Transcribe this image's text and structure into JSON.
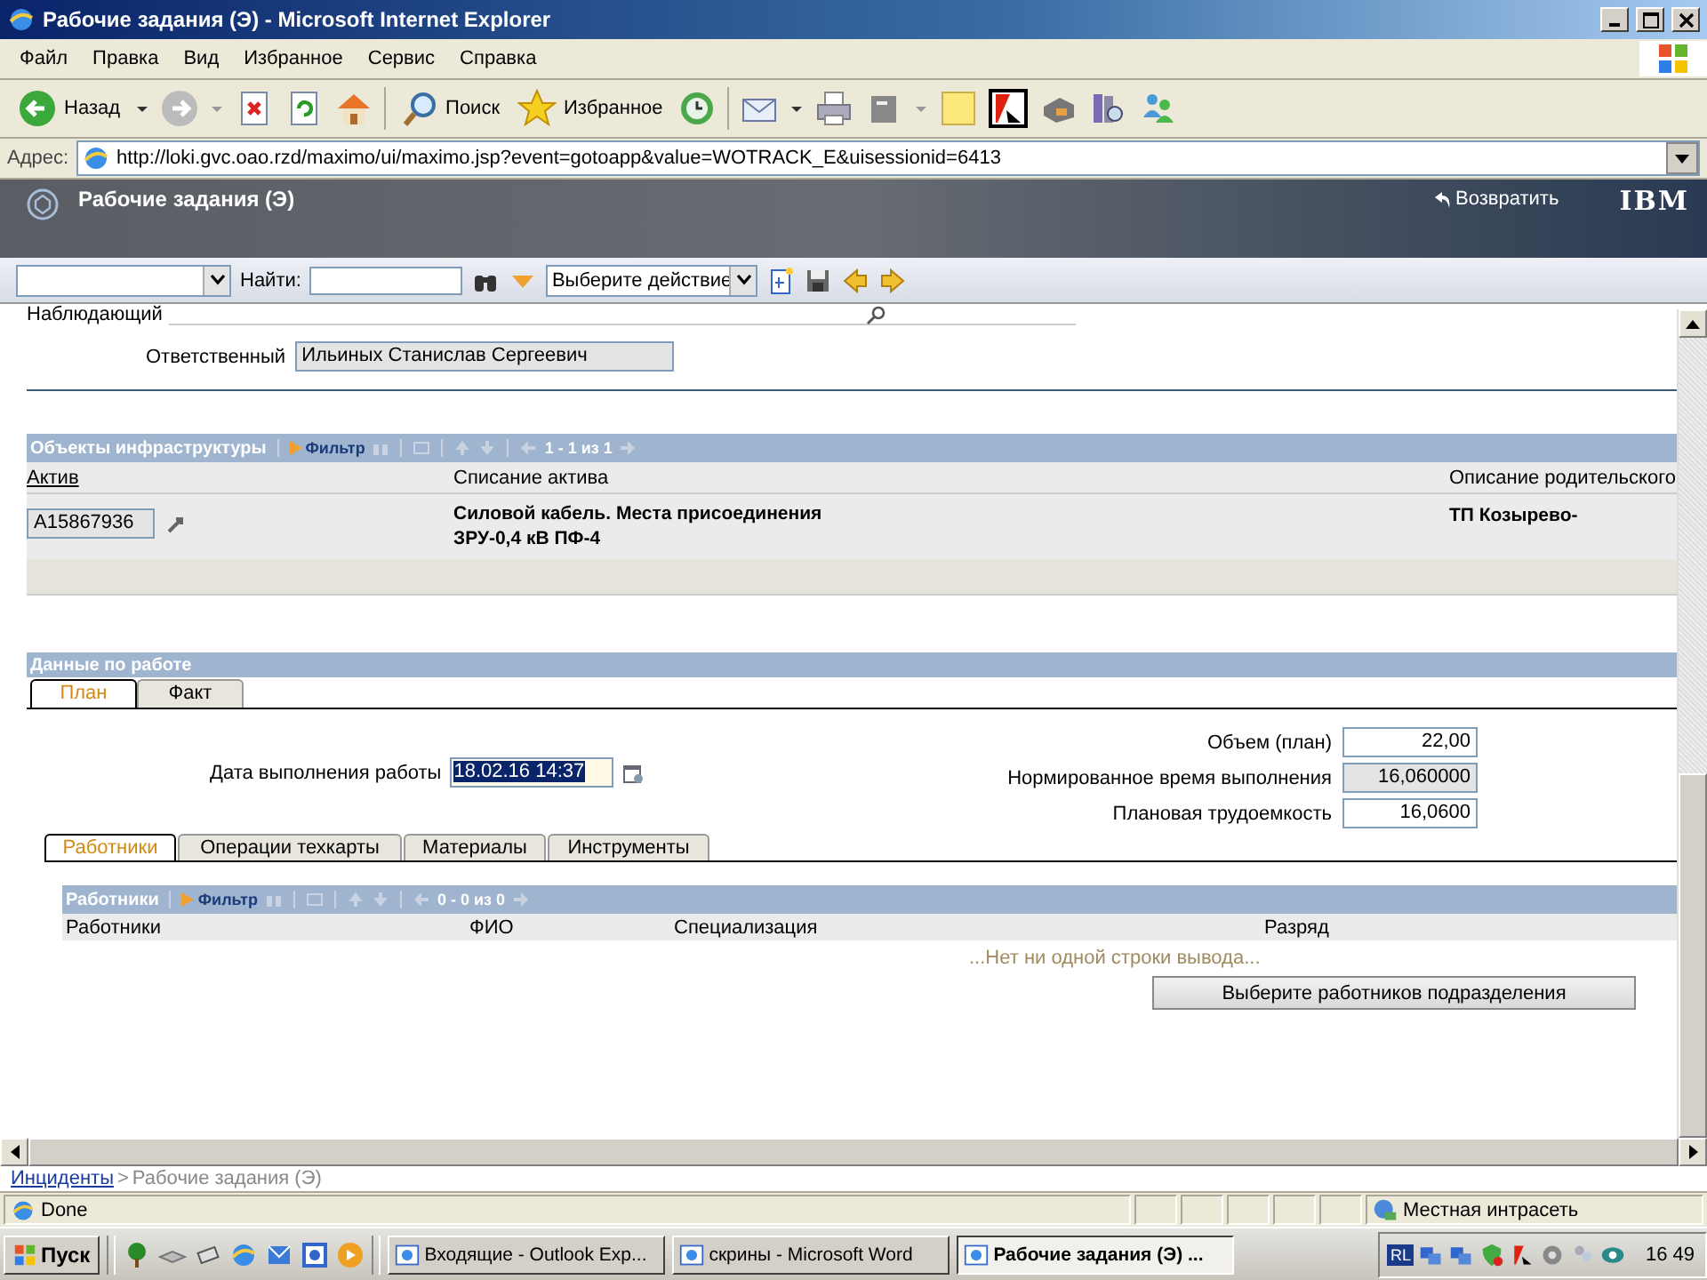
{
  "window": {
    "title": "Рабочие задания (Э) - Microsoft Internet Explorer"
  },
  "menu": [
    "Файл",
    "Правка",
    "Вид",
    "Избранное",
    "Сервис",
    "Справка"
  ],
  "toolbar": {
    "back": "Назад",
    "search": "Поиск",
    "favorites": "Избранное"
  },
  "address": {
    "label": "Адрес:",
    "url": "http://loki.gvc.oao.rzd/maximo/ui/maximo.jsp?event=gotoapp&value=WOTRACK_E&uisessionid=6413"
  },
  "app_header": {
    "title": "Рабочие задания (Э)",
    "return_link": "Возвратить",
    "logo": "IBM"
  },
  "app_toolbar": {
    "find_label": "Найти:",
    "action_select": "Выберите действие"
  },
  "form": {
    "observer_label": "Наблюдающий",
    "responsible_label": "Ответственный",
    "responsible_value": "Ильиных Станислав Сергеевич"
  },
  "assets": {
    "title": "Объекты инфраструктуры",
    "filter": "Фильтр",
    "pager": "1 - 1 из 1",
    "columns": [
      "Актив",
      "Списание актива",
      "Описание родительского"
    ],
    "rows": [
      {
        "asset": "A15867936",
        "description": "Силовой кабель. Места присоединения ЗРУ-0,4 кВ ПФ-4",
        "parent": "ТП Козырево-"
      }
    ]
  },
  "work": {
    "title": "Данные по работе",
    "tabs": [
      {
        "label": "План",
        "selected": true
      },
      {
        "label": "Факт",
        "selected": false
      }
    ],
    "date_label": "Дата выполнения работы",
    "date_value": "18.02.16 14:37",
    "date_highlighted": true,
    "fields": [
      {
        "label": "Объем (план)",
        "value": "22,00",
        "readonly": false
      },
      {
        "label": "Нормированное время выполнения",
        "value": "16,060000",
        "readonly": true
      },
      {
        "label": "Плановая трудоемкость",
        "value": "16,0600",
        "readonly": false
      }
    ]
  },
  "subtabs": [
    {
      "label": "Работники",
      "selected": true
    },
    {
      "label": "Операции техкарты",
      "selected": false
    },
    {
      "label": "Материалы",
      "selected": false
    },
    {
      "label": "Инструменты",
      "selected": false
    }
  ],
  "workers": {
    "title": "Работники",
    "filter": "Фильтр",
    "pager": "0 - 0 из 0",
    "columns": [
      "Работники",
      "ФИО",
      "Специализация",
      "Разряд"
    ],
    "empty": "...Нет ни одной строки вывода...",
    "button": "Выберите работников подразделения"
  },
  "breadcrumb": {
    "link": "Инциденты",
    "separator": ">",
    "current": "Рабочие задания (Э)"
  },
  "status_bar": {
    "text": "Done",
    "zone": "Местная интрасеть"
  },
  "taskbar": {
    "start": "Пуск",
    "tasks": [
      {
        "label": "Входящие - Outlook Exp...",
        "selected": false
      },
      {
        "label": "скрины - Microsoft Word",
        "selected": false
      },
      {
        "label": "Рабочие задания (Э) ...",
        "selected": true
      }
    ],
    "lang": "RL",
    "clock": "16 49"
  }
}
